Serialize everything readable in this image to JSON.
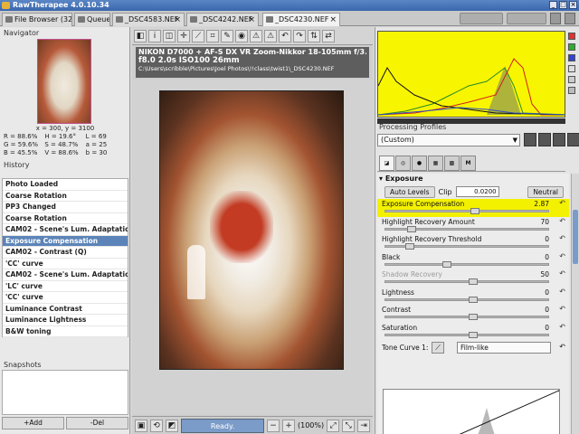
{
  "app": {
    "title": "RawTherapee 4.0.10.34"
  },
  "tabs": [
    {
      "label": "File Browser (32)"
    },
    {
      "label": "Queue"
    },
    {
      "label": "_DSC4583.NEF"
    },
    {
      "label": "_DSC4242.NEF"
    },
    {
      "label": "_DSC4230.NEF"
    }
  ],
  "navigator": {
    "label": "Navigator",
    "coords": "x = 300, y = 3100",
    "rows": [
      [
        "R = 88.6%",
        "H = 19.6°",
        "L = 69"
      ],
      [
        "G = 59.6%",
        "S = 48.7%",
        "a = 25"
      ],
      [
        "B = 45.5%",
        "V = 88.6%",
        "b = 30"
      ]
    ]
  },
  "history": {
    "label": "History",
    "items": [
      "Photo Loaded",
      "Coarse Rotation",
      "PP3 Changed",
      "Coarse Rotation",
      "CAM02 - Scene's Lum. Adaptation",
      "Exposure Compensation",
      "CAM02 - Contrast (Q)",
      "'CC' curve",
      "CAM02 - Scene's Lum. Adaptation",
      "'LC' curve",
      "'CC' curve",
      "Luminance Contrast",
      "Luminance Lightness",
      "B&W toning"
    ],
    "selected_index": 5
  },
  "snapshots": {
    "label": "Snapshots",
    "add_label": "+Add",
    "del_label": "-Del"
  },
  "exif": {
    "line1": "NIKON D7000 + AF-S DX VR Zoom-Nikkor 18-105mm f/3.5-5.6",
    "line2": "f8.0  2.0s  ISO100  26mm",
    "line3": "C:\\Users\\scribble\\Pictures\\Joel Photos\\!!class\\twist1\\_DSC4230.NEF"
  },
  "status": {
    "ready": "Ready.",
    "zoom": "(100%)"
  },
  "profiles": {
    "label": "Processing Profiles",
    "selected": "(Custom)"
  },
  "exposure": {
    "header": "Exposure",
    "auto_levels": "Auto Levels",
    "clip_label": "Clip",
    "clip_value": "0.0200",
    "neutral": "Neutral",
    "sliders": [
      {
        "name": "Exposure Compensation",
        "value": "2.87",
        "fraction": 0.55,
        "highlight": true,
        "disabled": false
      },
      {
        "name": "Highlight Recovery Amount",
        "value": "70",
        "fraction": 0.16,
        "highlight": false,
        "disabled": false
      },
      {
        "name": "Highlight Recovery Threshold",
        "value": "0",
        "fraction": 0.15,
        "highlight": false,
        "disabled": false
      },
      {
        "name": "Black",
        "value": "0",
        "fraction": 0.38,
        "highlight": false,
        "disabled": false
      },
      {
        "name": "Shadow Recovery",
        "value": "50",
        "fraction": 0.54,
        "highlight": false,
        "disabled": true
      },
      {
        "name": "Lightness",
        "value": "0",
        "fraction": 0.54,
        "highlight": false,
        "disabled": false
      },
      {
        "name": "Contrast",
        "value": "0",
        "fraction": 0.54,
        "highlight": false,
        "disabled": false
      },
      {
        "name": "Saturation",
        "value": "0",
        "fraction": 0.54,
        "highlight": false,
        "disabled": false
      }
    ],
    "tone_curve_label": "Tone Curve 1:",
    "tone_curve_type": "Film-like"
  },
  "colors": {
    "accent": "#5c84b8",
    "highlight": "#f3f100",
    "histogram_bg": "#f8f500"
  },
  "icons": {
    "toolbar": [
      "panel-toggle-icon",
      "info-icon",
      "before-after-icon",
      "crosshair-icon",
      "straighten-icon",
      "crop-icon",
      "color-picker-icon",
      "wb-icon",
      "warning-icon",
      "warning-icon",
      "rotate-left-icon",
      "rotate-right-icon",
      "flip-v-icon",
      "flip-h-icon"
    ]
  }
}
